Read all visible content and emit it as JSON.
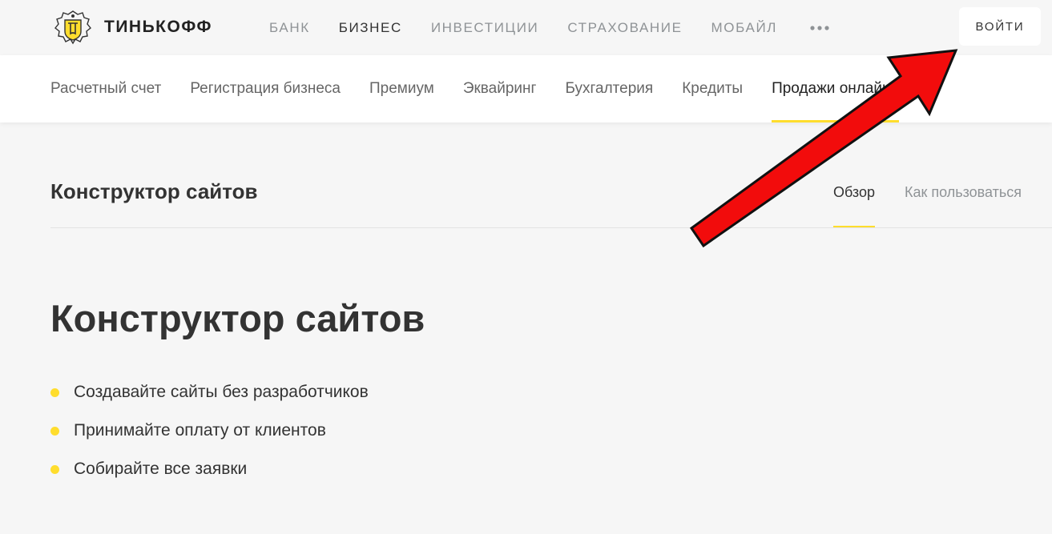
{
  "brand": {
    "name": "ТИНЬКОФФ",
    "emblem_icon": "tinkoff-crest-icon",
    "emblem_color": "#ffdd2d"
  },
  "top_nav": {
    "items": [
      {
        "label": "БАНК",
        "active": false
      },
      {
        "label": "БИЗНЕС",
        "active": true
      },
      {
        "label": "ИНВЕСТИЦИИ",
        "active": false
      },
      {
        "label": "СТРАХОВАНИЕ",
        "active": false
      },
      {
        "label": "МОБАЙЛ",
        "active": false
      }
    ],
    "more_icon": "ellipsis-icon",
    "login_label": "ВОЙТИ"
  },
  "sub_nav": {
    "items": [
      {
        "label": "Расчетный счет",
        "active": false
      },
      {
        "label": "Регистрация бизнеса",
        "active": false
      },
      {
        "label": "Премиум",
        "active": false
      },
      {
        "label": "Эквайринг",
        "active": false
      },
      {
        "label": "Бухгалтерия",
        "active": false
      },
      {
        "label": "Кредиты",
        "active": false
      },
      {
        "label": "Продажи онлайне",
        "active": true
      }
    ]
  },
  "product": {
    "title": "Конструктор сайтов",
    "tabs": [
      {
        "label": "Обзор",
        "active": true
      },
      {
        "label": "Как пользоваться",
        "active": false
      }
    ]
  },
  "hero": {
    "title": "Конструктор сайтов",
    "features": [
      "Создавайте сайты без разработчиков",
      "Принимайте оплату от клиентов",
      "Собирайте все заявки"
    ]
  },
  "colors": {
    "accent": "#ffdd2d",
    "background": "#f6f6f6",
    "annotation_arrow": "#f20c0c"
  }
}
